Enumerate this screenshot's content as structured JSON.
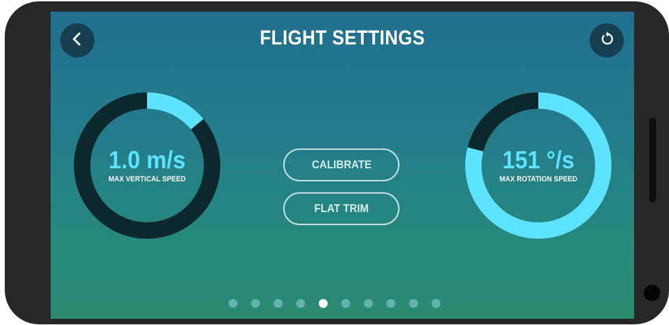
{
  "screen": {
    "title": "FLIGHT SETTINGS"
  },
  "toolbar": {
    "back_icon": "chevron-left-icon",
    "reset_icon": "rotate-ccw-icon"
  },
  "gauges": {
    "vertical_speed": {
      "value": "1.0 m/s",
      "label": "MAX VERTICAL SPEED",
      "fill_fraction": 0.14
    },
    "rotation_speed": {
      "value": "151 °/s",
      "label": "MAX ROTATION SPEED",
      "fill_fraction": 0.79
    }
  },
  "actions": {
    "calibrate_label": "CALIBRATE",
    "flat_trim_label": "FLAT TRIM"
  },
  "pagination": {
    "total_pages": 10,
    "active_page": 5
  },
  "colors": {
    "accent": "#5de3ff",
    "track": "#0d282c",
    "gradient_top": "#226f90",
    "gradient_bottom": "#2a8a70"
  }
}
